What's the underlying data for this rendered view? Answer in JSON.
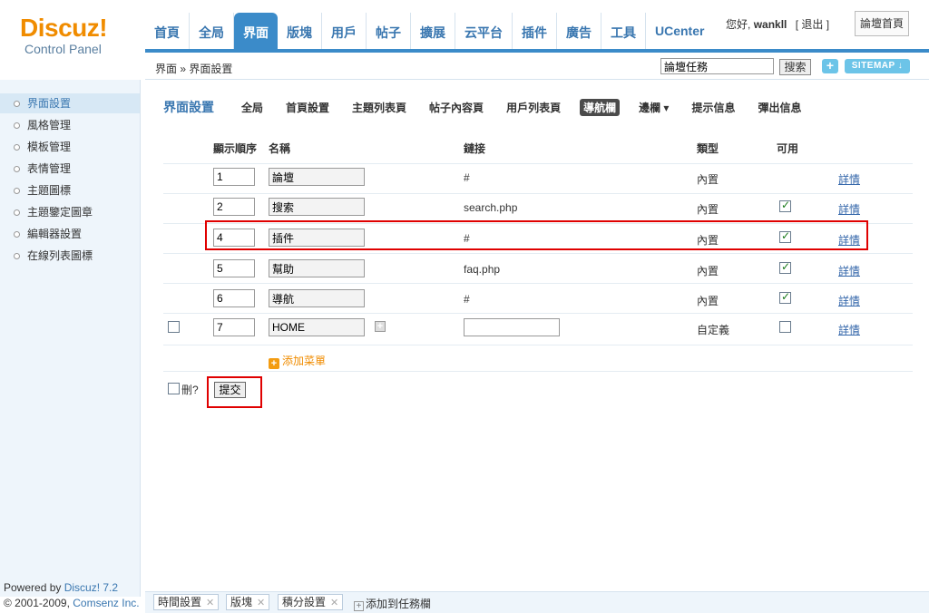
{
  "logo": {
    "main": "Discuz!",
    "sub": "Control Panel"
  },
  "nav": [
    "首頁",
    "全局",
    "界面",
    "版塊",
    "用戶",
    "帖子",
    "擴展",
    "云平台",
    "插件",
    "廣告",
    "工具",
    "UCenter"
  ],
  "user": {
    "greeting": "您好,",
    "name": "wankll",
    "logout": "[ 退出 ]",
    "home": "論壇首頁"
  },
  "breadcrumb": "界面 » 界面設置",
  "quicksearch": {
    "value": "論壇任務",
    "button": "搜索",
    "plus": "+",
    "sitemap": "SITEMAP ↓"
  },
  "sidebar": [
    "界面設置",
    "風格管理",
    "模板管理",
    "表情管理",
    "主題圖標",
    "主題鑒定圖章",
    "編輯器設置",
    "在線列表圖標"
  ],
  "powered": {
    "line1a": "Powered by ",
    "line1b": "Discuz! 7.2",
    "line2a": "© 2001-2009, ",
    "line2b": "Comsenz Inc."
  },
  "subnav": {
    "title": "界面設置",
    "items": [
      "全局",
      "首頁設置",
      "主題列表頁",
      "帖子內容頁",
      "用戶列表頁",
      "導航欄",
      "邊欄 ▾",
      "提示信息",
      "彈出信息"
    ]
  },
  "table": {
    "headers": [
      "顯示順序",
      "名稱",
      "鏈接",
      "類型",
      "可用"
    ],
    "rows": [
      {
        "order": "1",
        "name": "論壇",
        "link": "#",
        "type": "內置",
        "enabled": false,
        "detail": "詳情"
      },
      {
        "order": "2",
        "name": "搜索",
        "link": "search.php",
        "type": "內置",
        "enabled": true,
        "detail": "詳情"
      },
      {
        "order": "4",
        "name": "插件",
        "link": "#",
        "type": "內置",
        "enabled": true,
        "detail": "詳情"
      },
      {
        "order": "5",
        "name": "幫助",
        "link": "faq.php",
        "type": "內置",
        "enabled": true,
        "detail": "詳情"
      },
      {
        "order": "6",
        "name": "導航",
        "link": "#",
        "type": "內置",
        "enabled": true,
        "detail": "詳情"
      },
      {
        "order": "7",
        "name": "HOME",
        "link": "",
        "type": "自定義",
        "enabled": false,
        "detail": "詳情"
      }
    ],
    "add_menu": "添加菜單",
    "delete_label": "刪?",
    "submit": "提交"
  },
  "taskbar": {
    "tasks": [
      "時間設置",
      "版塊",
      "積分設置"
    ],
    "add": "添加到任務欄"
  }
}
